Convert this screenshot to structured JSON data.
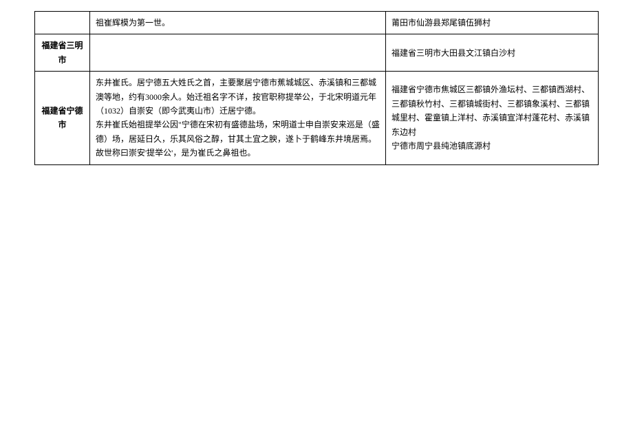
{
  "rows": [
    {
      "region": "",
      "desc": "祖崔辉模为第一世。",
      "loc": "莆田市仙游县郑尾镇伍狮村"
    },
    {
      "region": "福建省三明市",
      "desc": "",
      "loc": "福建省三明市大田县文江镇白沙村"
    },
    {
      "region": "福建省宁德市",
      "desc": "东井崔氏。居宁德五大姓氏之首，主要聚居宁德市蕉城城区、赤溪镇和三都城澳等地，约有3000余人。始迁祖名字不详，按官职称提举公，于北宋明道元年（1032）自崇安（即今武夷山市）迁居宁德。\n东井崔氏始祖提举公因\"宁德在宋初有盛德盐场，宋明道士申自崇安来巡是（盛德）场，居延日久，乐其风俗之醇，甘其土宜之腴，遂卜于鹤峰东井境居焉。故世称曰崇安'提举公'，是为崔氏之鼻祖也。",
      "loc": "福建省宁德市焦城区三都镇外渔坛村、三都镇西湖村、三都镇秋竹村、三都镇城街村、三都镇象溪村、三都镇城里村、霍童镇上洋村、赤溪镇宣洋村蓬花村、赤溪镇东边村\n宁德市周宁县纯池镇底源村"
    }
  ]
}
